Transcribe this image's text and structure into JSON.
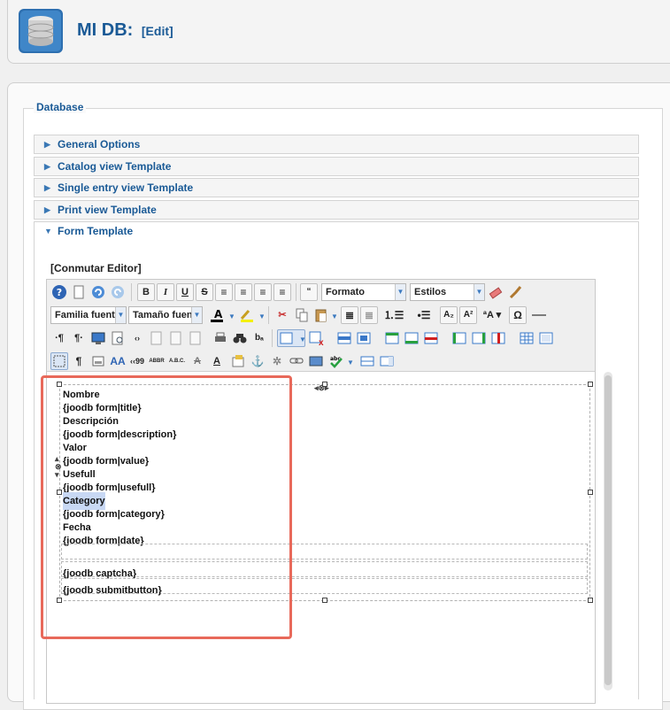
{
  "header": {
    "title": "MI DB:",
    "edit": "[Edit]"
  },
  "legend": "Database",
  "accordion": [
    {
      "label": "General Options",
      "open": false
    },
    {
      "label": "Catalog view Template",
      "open": false
    },
    {
      "label": "Single entry view Template",
      "open": false
    },
    {
      "label": "Print view Template",
      "open": false
    },
    {
      "label": "Form Template",
      "open": true
    }
  ],
  "toggle_editor": "[Conmutar Editor]",
  "toolbar": {
    "format_select": "Formato",
    "styles_select": "Estilos",
    "font_family_select": "Familia fuente",
    "font_size_select": "Tamaño fuente",
    "row1": [
      "help",
      "new-document",
      "undo",
      "redo",
      "bold",
      "italic",
      "underline",
      "strikethrough",
      "align-justify",
      "align-center",
      "align-left",
      "align-right",
      "blockquote",
      "eraser",
      "paint-brush"
    ],
    "row2": [
      "text-color",
      "highlight-color",
      "cut",
      "copy",
      "paste",
      "indent",
      "outdent",
      "ordered-list",
      "unordered-list",
      "subscript",
      "superscript",
      "font-size",
      "special-char",
      "horizontal-rule"
    ]
  },
  "content": {
    "lines": [
      "Nombre",
      "{joodb form|title}",
      "Descripción",
      "{joodb form|description}",
      "Valor",
      "{joodb form|value}",
      "Usefull",
      "{joodb form|usefull}",
      "Category",
      "{joodb form|category}",
      "Fecha",
      "{joodb form|date}"
    ],
    "captcha": "{joodb captcha}",
    "submit": "{joodb submitbutton}",
    "highlighted": "Category"
  },
  "colors": {
    "accent": "#1a5a96",
    "highlight_box": "#e8695a"
  }
}
